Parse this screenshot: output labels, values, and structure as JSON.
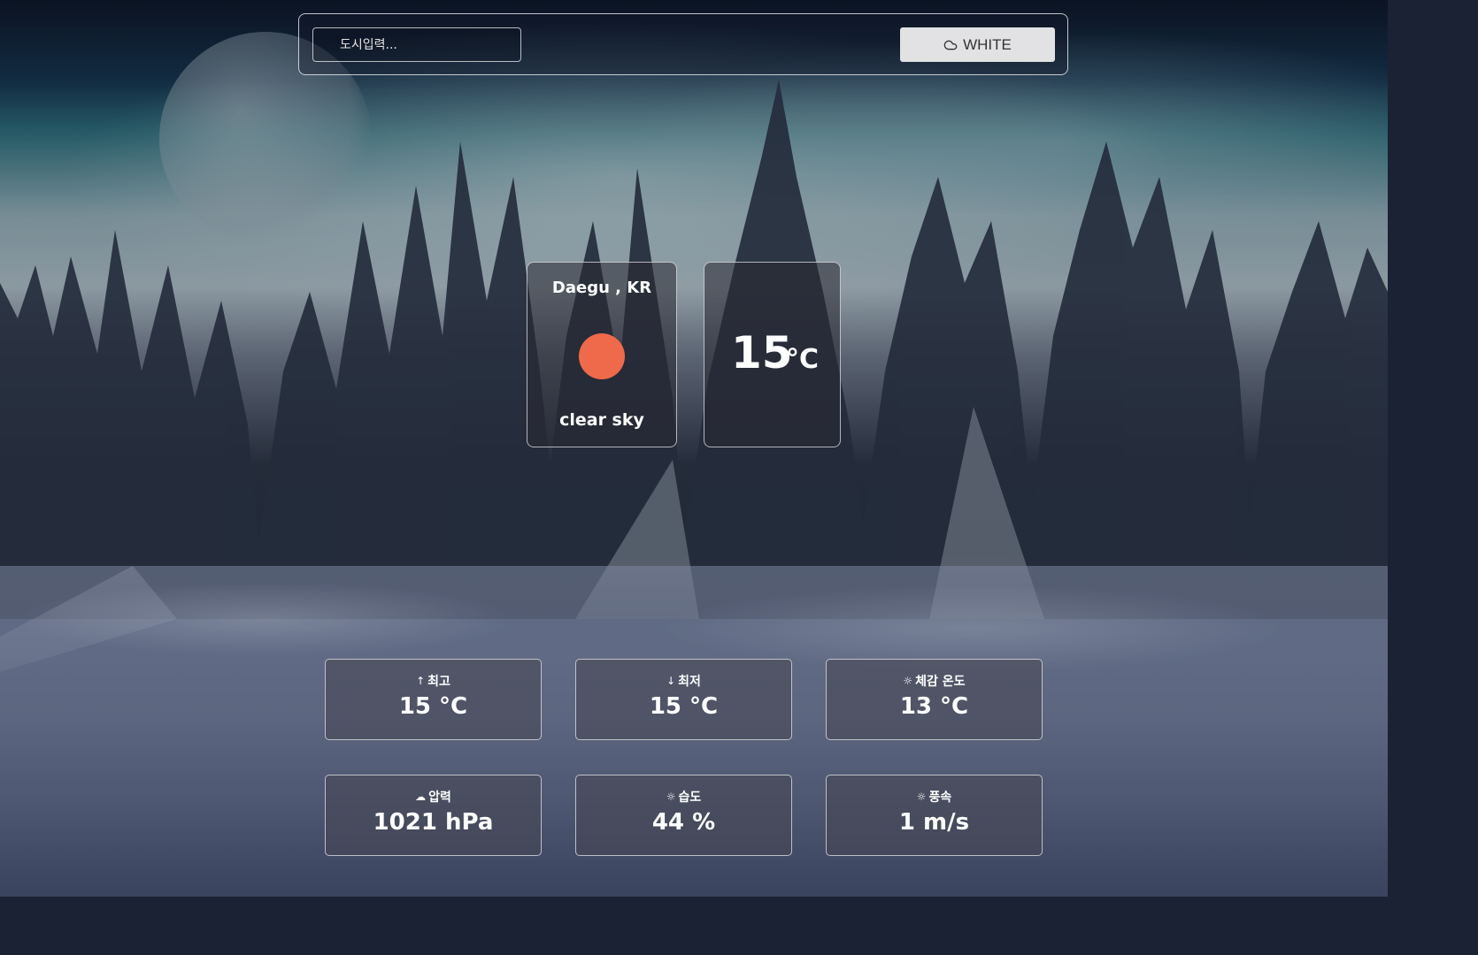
{
  "search": {
    "placeholder": "도시입력..."
  },
  "theme_button": {
    "label": "WHITE",
    "icon": "cloud-icon"
  },
  "location": {
    "name": "Daegu , KR",
    "icon": "sun-icon",
    "description": "clear sky"
  },
  "temperature": {
    "value": "15",
    "unit": "°C"
  },
  "stats": [
    {
      "label": "최고",
      "icon": "arrow-up-icon",
      "value": "15 °C"
    },
    {
      "label": "최저",
      "icon": "arrow-down-icon",
      "value": "15 °C"
    },
    {
      "label": "체감 온도",
      "icon": "weather-icon",
      "value": "13 °C"
    },
    {
      "label": "압력",
      "icon": "cloud-icon",
      "value": "1021 hPa"
    },
    {
      "label": "습도",
      "icon": "weather-icon",
      "value": "44 %"
    },
    {
      "label": "풍속",
      "icon": "weather-icon",
      "value": "1 m/s"
    }
  ],
  "colors": {
    "sun": "#ee6a4a",
    "button_bg": "#e2e2e4"
  }
}
